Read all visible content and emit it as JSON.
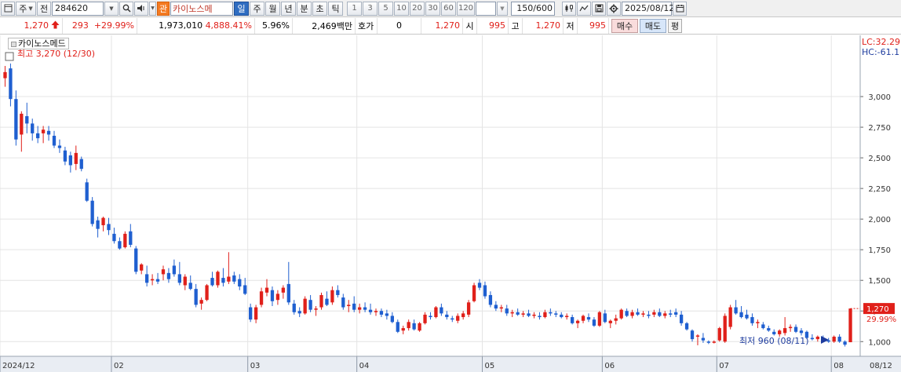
{
  "toolbar": {
    "market_label": "주",
    "prev_label": "전",
    "code": "284620",
    "tag_label": "관",
    "stock_name": "카이노스메",
    "period_tabs": [
      {
        "label": "일",
        "selected": true
      },
      {
        "label": "주",
        "selected": false
      },
      {
        "label": "월",
        "selected": false
      },
      {
        "label": "년",
        "selected": false
      },
      {
        "label": "분",
        "selected": false
      },
      {
        "label": "초",
        "selected": false
      },
      {
        "label": "틱",
        "selected": false
      }
    ],
    "intervals": [
      "1",
      "3",
      "5",
      "10",
      "20",
      "30",
      "60",
      "120"
    ],
    "count_value": "150",
    "count_total": "/600",
    "date": "2025/08/12"
  },
  "quote": {
    "price": "1,270",
    "change": "293",
    "change_rate": "+29.99%",
    "volume": "1,973,010",
    "volume_rate": "4,888.41%",
    "turnover_rate": "5.96%",
    "amount": "2,469백만",
    "quote_label": "호가",
    "quote_value": "0",
    "bid_price": "1,270",
    "open_label": "시",
    "open": "995",
    "high_label": "고",
    "high": "1,270",
    "low_label": "저",
    "low": "995",
    "buy_label": "매수",
    "sell_label": "매도",
    "eval_label": "평"
  },
  "chart": {
    "legend_name": "카이노스메드",
    "high_note": "최고 3,270 (12/30)",
    "low_note": "최저 960 (08/11)",
    "lc_label": "LC:32.29",
    "hc_label": "HC:-61.1",
    "current_price_label": "1,270",
    "current_change_label": "29.99%",
    "colors": {
      "up": "#e0201a",
      "down": "#1f5fd0",
      "grid": "#e4e4e4"
    }
  },
  "chart_data": {
    "type": "candlestick",
    "y_ticks": [
      "3,000",
      "2,750",
      "2,500",
      "2,250",
      "2,000",
      "1,750",
      "1,500",
      "1,250",
      "1,000"
    ],
    "x_ticks": [
      "2024/12",
      "02",
      "03",
      "04",
      "05",
      "06",
      "07",
      "08",
      "08/12"
    ],
    "ylim": [
      880,
      3500
    ],
    "grid": true,
    "candles": [
      [
        3150,
        3250,
        3080,
        3200
      ],
      [
        3230,
        3270,
        2920,
        2980
      ],
      [
        2980,
        3050,
        2600,
        2650
      ],
      [
        2690,
        2880,
        2550,
        2860
      ],
      [
        2840,
        2950,
        2700,
        2780
      ],
      [
        2780,
        2820,
        2640,
        2700
      ],
      [
        2700,
        2760,
        2620,
        2660
      ],
      [
        2700,
        2760,
        2620,
        2730
      ],
      [
        2720,
        2760,
        2640,
        2690
      ],
      [
        2680,
        2720,
        2580,
        2600
      ],
      [
        2600,
        2650,
        2540,
        2580
      ],
      [
        2560,
        2590,
        2440,
        2470
      ],
      [
        2520,
        2550,
        2380,
        2440
      ],
      [
        2450,
        2600,
        2400,
        2540
      ],
      [
        2490,
        2510,
        2390,
        2410
      ],
      [
        2300,
        2330,
        2140,
        2150
      ],
      [
        2150,
        2180,
        1940,
        1960
      ],
      [
        1990,
        2020,
        1850,
        1920
      ],
      [
        1950,
        2020,
        1900,
        2010
      ],
      [
        1960,
        2010,
        1870,
        1910
      ],
      [
        1880,
        1930,
        1800,
        1820
      ],
      [
        1820,
        1850,
        1750,
        1760
      ],
      [
        1770,
        1900,
        1760,
        1880
      ],
      [
        1900,
        1960,
        1770,
        1790
      ],
      [
        1760,
        1780,
        1550,
        1570
      ],
      [
        1580,
        1640,
        1550,
        1630
      ],
      [
        1550,
        1620,
        1450,
        1480
      ],
      [
        1500,
        1550,
        1460,
        1510
      ],
      [
        1510,
        1560,
        1470,
        1490
      ],
      [
        1550,
        1620,
        1500,
        1590
      ],
      [
        1560,
        1600,
        1480,
        1510
      ],
      [
        1620,
        1670,
        1530,
        1550
      ],
      [
        1550,
        1650,
        1460,
        1480
      ],
      [
        1460,
        1550,
        1420,
        1530
      ],
      [
        1480,
        1540,
        1420,
        1430
      ],
      [
        1430,
        1470,
        1280,
        1300
      ],
      [
        1310,
        1360,
        1260,
        1340
      ],
      [
        1340,
        1470,
        1330,
        1460
      ],
      [
        1520,
        1570,
        1450,
        1460
      ],
      [
        1460,
        1580,
        1440,
        1570
      ],
      [
        1520,
        1600,
        1450,
        1480
      ],
      [
        1490,
        1730,
        1470,
        1530
      ],
      [
        1540,
        1570,
        1470,
        1490
      ],
      [
        1510,
        1550,
        1420,
        1450
      ],
      [
        1460,
        1520,
        1380,
        1390
      ],
      [
        1280,
        1310,
        1160,
        1180
      ],
      [
        1180,
        1300,
        1150,
        1280
      ],
      [
        1300,
        1440,
        1280,
        1410
      ],
      [
        1400,
        1510,
        1370,
        1440
      ],
      [
        1420,
        1450,
        1290,
        1330
      ],
      [
        1340,
        1420,
        1300,
        1390
      ],
      [
        1400,
        1460,
        1350,
        1440
      ],
      [
        1470,
        1650,
        1300,
        1320
      ],
      [
        1310,
        1340,
        1220,
        1240
      ],
      [
        1250,
        1280,
        1200,
        1230
      ],
      [
        1230,
        1370,
        1220,
        1350
      ],
      [
        1340,
        1380,
        1240,
        1260
      ],
      [
        1260,
        1290,
        1210,
        1270
      ],
      [
        1280,
        1400,
        1260,
        1380
      ],
      [
        1350,
        1410,
        1290,
        1300
      ],
      [
        1320,
        1450,
        1300,
        1420
      ],
      [
        1420,
        1460,
        1360,
        1380
      ],
      [
        1360,
        1390,
        1260,
        1280
      ],
      [
        1290,
        1340,
        1240,
        1300
      ],
      [
        1310,
        1370,
        1240,
        1260
      ],
      [
        1260,
        1310,
        1230,
        1280
      ],
      [
        1280,
        1320,
        1240,
        1260
      ],
      [
        1260,
        1310,
        1220,
        1240
      ],
      [
        1240,
        1270,
        1210,
        1250
      ],
      [
        1250,
        1270,
        1200,
        1220
      ],
      [
        1230,
        1260,
        1180,
        1210
      ],
      [
        1210,
        1240,
        1150,
        1160
      ],
      [
        1160,
        1180,
        1070,
        1080
      ],
      [
        1090,
        1130,
        1060,
        1110
      ],
      [
        1110,
        1180,
        1090,
        1160
      ],
      [
        1150,
        1180,
        1090,
        1100
      ],
      [
        1090,
        1160,
        1080,
        1150
      ],
      [
        1150,
        1240,
        1140,
        1220
      ],
      [
        1210,
        1240,
        1180,
        1200
      ],
      [
        1200,
        1290,
        1190,
        1280
      ],
      [
        1280,
        1310,
        1210,
        1230
      ],
      [
        1220,
        1250,
        1180,
        1200
      ],
      [
        1190,
        1210,
        1160,
        1180
      ],
      [
        1170,
        1230,
        1150,
        1210
      ],
      [
        1200,
        1250,
        1180,
        1230
      ],
      [
        1220,
        1340,
        1200,
        1320
      ],
      [
        1330,
        1480,
        1320,
        1460
      ],
      [
        1480,
        1510,
        1420,
        1440
      ],
      [
        1460,
        1490,
        1350,
        1370
      ],
      [
        1380,
        1410,
        1280,
        1300
      ],
      [
        1300,
        1330,
        1250,
        1270
      ],
      [
        1270,
        1300,
        1240,
        1280
      ],
      [
        1270,
        1300,
        1210,
        1230
      ],
      [
        1230,
        1260,
        1200,
        1240
      ],
      [
        1240,
        1270,
        1210,
        1220
      ],
      [
        1220,
        1250,
        1200,
        1230
      ],
      [
        1230,
        1260,
        1200,
        1210
      ],
      [
        1210,
        1240,
        1190,
        1220
      ],
      [
        1210,
        1240,
        1180,
        1200
      ],
      [
        1200,
        1260,
        1190,
        1240
      ],
      [
        1240,
        1270,
        1210,
        1230
      ],
      [
        1230,
        1250,
        1200,
        1220
      ],
      [
        1220,
        1240,
        1190,
        1200
      ],
      [
        1200,
        1230,
        1180,
        1210
      ],
      [
        1200,
        1220,
        1140,
        1150
      ],
      [
        1150,
        1180,
        1110,
        1170
      ],
      [
        1170,
        1220,
        1150,
        1210
      ],
      [
        1200,
        1230,
        1160,
        1180
      ],
      [
        1180,
        1200,
        1120,
        1130
      ],
      [
        1130,
        1250,
        1120,
        1240
      ],
      [
        1230,
        1260,
        1150,
        1160
      ],
      [
        1150,
        1180,
        1110,
        1170
      ],
      [
        1170,
        1220,
        1140,
        1190
      ],
      [
        1190,
        1270,
        1180,
        1260
      ],
      [
        1250,
        1270,
        1200,
        1210
      ],
      [
        1210,
        1260,
        1190,
        1240
      ],
      [
        1240,
        1270,
        1210,
        1220
      ],
      [
        1220,
        1250,
        1200,
        1230
      ],
      [
        1220,
        1250,
        1190,
        1210
      ],
      [
        1220,
        1260,
        1200,
        1240
      ],
      [
        1240,
        1270,
        1200,
        1210
      ],
      [
        1210,
        1250,
        1190,
        1230
      ],
      [
        1230,
        1260,
        1200,
        1220
      ],
      [
        1240,
        1270,
        1200,
        1220
      ],
      [
        1220,
        1250,
        1130,
        1150
      ],
      [
        1150,
        1160,
        1090,
        1100
      ],
      [
        1090,
        1100,
        1000,
        1020
      ],
      [
        1040,
        1060,
        970,
        1050
      ],
      [
        1030,
        1070,
        990,
        1010
      ],
      [
        1000,
        1010,
        980,
        995
      ],
      [
        995,
        1010,
        985,
        1000
      ],
      [
        1010,
        1120,
        1000,
        1110
      ],
      [
        1000,
        1230,
        990,
        1210
      ],
      [
        1120,
        1300,
        1100,
        1280
      ],
      [
        1280,
        1340,
        1220,
        1230
      ],
      [
        1240,
        1290,
        1190,
        1200
      ],
      [
        1220,
        1260,
        1180,
        1190
      ],
      [
        1200,
        1230,
        1130,
        1150
      ],
      [
        1150,
        1180,
        1110,
        1160
      ],
      [
        1140,
        1160,
        1100,
        1110
      ],
      [
        1110,
        1130,
        1080,
        1090
      ],
      [
        1080,
        1100,
        1050,
        1060
      ],
      [
        1060,
        1100,
        1040,
        1090
      ],
      [
        1070,
        1200,
        1050,
        1110
      ],
      [
        1110,
        1140,
        1080,
        1120
      ],
      [
        1120,
        1140,
        1070,
        1080
      ],
      [
        1090,
        1110,
        1050,
        1070
      ],
      [
        1080,
        1090,
        1020,
        1030
      ],
      [
        1030,
        1060,
        1010,
        1020
      ],
      [
        1020,
        1050,
        1000,
        1040
      ],
      [
        1030,
        1050,
        1000,
        1010
      ],
      [
        1010,
        1030,
        990,
        1000
      ],
      [
        1000,
        1050,
        990,
        1040
      ],
      [
        1040,
        1060,
        990,
        1000
      ],
      [
        1000,
        1010,
        960,
        975
      ],
      [
        995,
        1270,
        995,
        1270
      ]
    ],
    "x_tick_indices": [
      0,
      20,
      45,
      65,
      88,
      110,
      131,
      152,
      160
    ]
  }
}
